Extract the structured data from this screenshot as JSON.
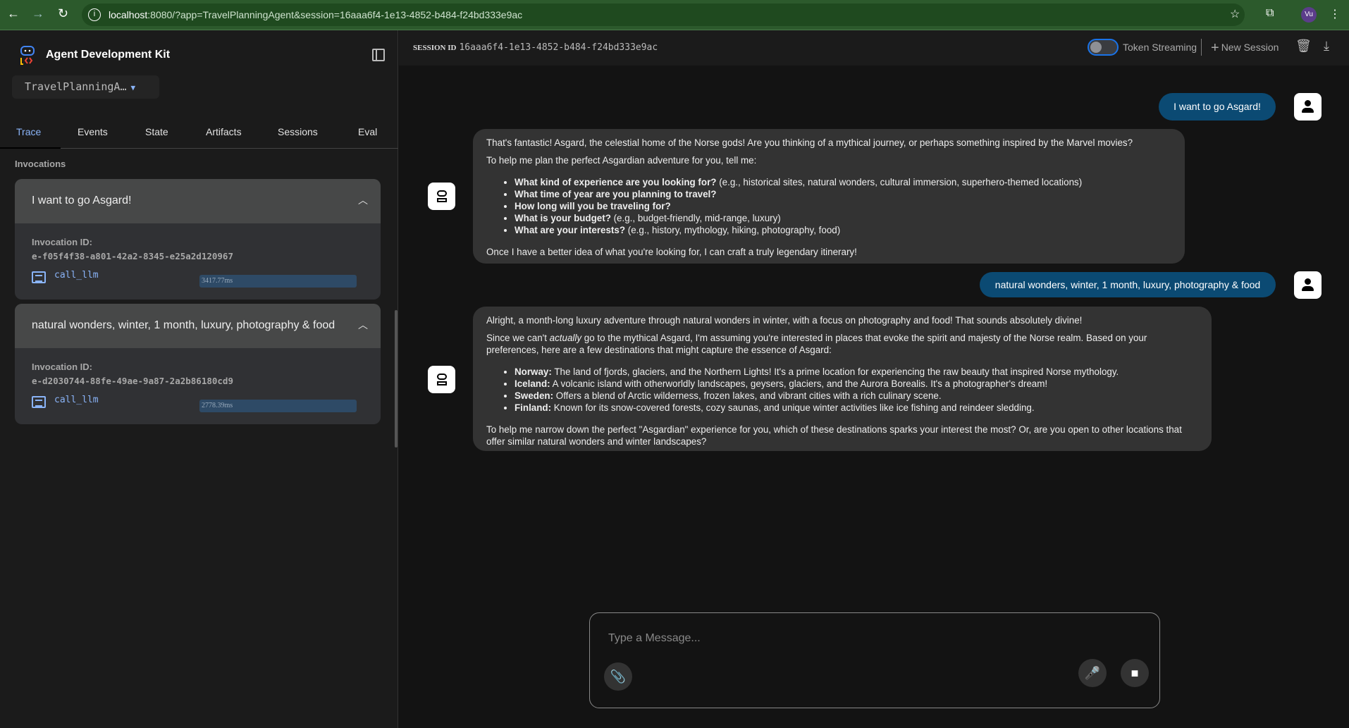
{
  "browser": {
    "url_host": "localhost",
    "url_rest": ":8080/?app=TravelPlanningAgent&session=16aaa6f4-1e13-4852-b484-f24bd333e9ac",
    "profile": "Vu"
  },
  "sidebar": {
    "title": "Agent Development Kit",
    "app_select": "TravelPlanningA…",
    "tabs": [
      "Trace",
      "Events",
      "State",
      "Artifacts",
      "Sessions",
      "Eval"
    ],
    "invocations_label": "Invocations",
    "invocations": [
      {
        "title": "I want to go Asgard!",
        "id_label": "Invocation ID:",
        "id": "e-f05f4f38-a801-42a2-8345-e25a2d120967",
        "fn": "call_llm",
        "duration": "3417.77ms"
      },
      {
        "title": "natural wonders, winter, 1 month, luxury, photography & food",
        "id_label": "Invocation ID:",
        "id": "e-d2030744-88fe-49ae-9a87-2a2b86180cd9",
        "fn": "call_llm",
        "duration": "2778.39ms"
      }
    ]
  },
  "header": {
    "session_label": "SESSION ID",
    "session_id": "16aaa6f4-1e13-4852-b484-f24bd333e9ac",
    "token_streaming": "Token Streaming",
    "new_session": "New Session"
  },
  "chat": {
    "user1": "I want to go Asgard!",
    "bot1": {
      "p1": "That's fantastic! Asgard, the celestial home of the Norse gods! Are you thinking of a mythical journey, or perhaps something inspired by the Marvel movies?",
      "p2": "To help me plan the perfect Asgardian adventure for you, tell me:",
      "items": [
        {
          "b": "What kind of experience are you looking for?",
          "t": " (e.g., historical sites, natural wonders, cultural immersion, superhero-themed locations)"
        },
        {
          "b": "What time of year are you planning to travel?",
          "t": ""
        },
        {
          "b": "How long will you be traveling for?",
          "t": ""
        },
        {
          "b": "What is your budget?",
          "t": " (e.g., budget-friendly, mid-range, luxury)"
        },
        {
          "b": "What are your interests?",
          "t": " (e.g., history, mythology, hiking, photography, food)"
        }
      ],
      "p3": "Once I have a better idea of what you're looking for, I can craft a truly legendary itinerary!"
    },
    "user2": "natural wonders, winter, 1 month, luxury, photography & food",
    "bot2": {
      "p1": "Alright, a month-long luxury adventure through natural wonders in winter, with a focus on photography and food! That sounds absolutely divine!",
      "p2a": "Since we can't ",
      "p2em": "actually",
      "p2b": " go to the mythical Asgard, I'm assuming you're interested in places that evoke the spirit and majesty of the Norse realm. Based on your preferences, here are a few destinations that might capture the essence of Asgard:",
      "items": [
        {
          "b": "Norway:",
          "t": " The land of fjords, glaciers, and the Northern Lights! It's a prime location for experiencing the raw beauty that inspired Norse mythology."
        },
        {
          "b": "Iceland:",
          "t": " A volcanic island with otherworldly landscapes, geysers, glaciers, and the Aurora Borealis. It's a photographer's dream!"
        },
        {
          "b": "Sweden:",
          "t": " Offers a blend of Arctic wilderness, frozen lakes, and vibrant cities with a rich culinary scene."
        },
        {
          "b": "Finland:",
          "t": " Known for its snow-covered forests, cozy saunas, and unique winter activities like ice fishing and reindeer sledding."
        }
      ],
      "p3": "To help me narrow down the perfect \"Asgardian\" experience for you, which of these destinations sparks your interest the most? Or, are you open to other locations that offer similar natural wonders and winter landscapes?"
    }
  },
  "input": {
    "placeholder": "Type a Message..."
  }
}
